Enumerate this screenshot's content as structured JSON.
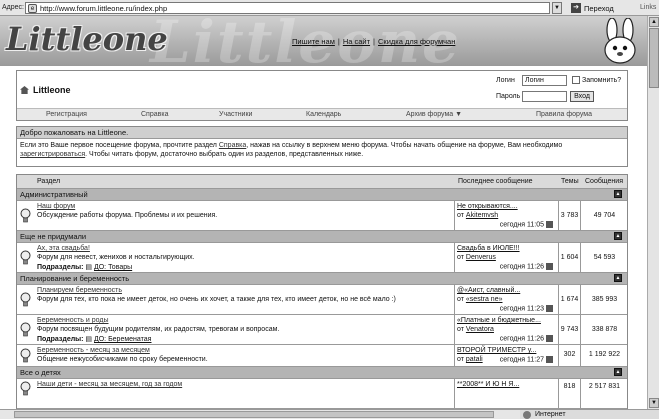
{
  "browser": {
    "address_label": "Адрес:",
    "url": "http://www.forum.littleone.ru/index.php",
    "go_label": "Переход",
    "links_label": "Links"
  },
  "banner": {
    "logo_text": "Littleone",
    "links": [
      "Пишите нам",
      "На сайт",
      "Скидка для форумчан"
    ]
  },
  "header": {
    "site_title": "Littleone",
    "login_label": "Логин",
    "login_value": "Логин",
    "remember_label": "Запомнить?",
    "password_label": "Пароль",
    "enter_label": "Вход",
    "nav": [
      "Регистрация",
      "Справка",
      "Участники",
      "Календарь",
      "Архив форума ▼",
      "Правила форума"
    ]
  },
  "welcome": {
    "title": "Добро пожаловать на Littleone.",
    "text1": "Если это Ваше первое посещение форума, прочтите раздел",
    "link_help": "Справка",
    "text2": ", нажав на ссылку в верхнем меню форума. Чтобы начать общение на форуме, Вам необходимо",
    "link_register": "зарегистрироваться",
    "text3": ". Чтобы читать форум, достаточно выбрать один из разделов, представленных ниже."
  },
  "table": {
    "col_section": "Раздел",
    "col_last": "Последнее сообщение",
    "col_topics": "Темы",
    "col_messages": "Сообщения",
    "categories": [
      {
        "title": "Административный",
        "forums": [
          {
            "name": "Наш форум",
            "desc": "Обсуждение работы форума. Проблемы и их решения.",
            "sub_label": "",
            "sub_link": "",
            "last_title": "Не открываются....",
            "last_by": "от",
            "last_author": "Akitemvsh",
            "last_time": "сегодня 11:05",
            "topics": "3 783",
            "messages": "49 704"
          }
        ]
      },
      {
        "title": "Еще не придумали",
        "forums": [
          {
            "name": "Ах, эта свадьба!",
            "desc": "Форум для невест, женихов и ностальгирующих.",
            "sub_label": "Подразделы:",
            "sub_link": "ДО: Товары",
            "last_title": "Свадьба в ИЮЛЕ!!!",
            "last_by": "от",
            "last_author": "Denverus",
            "last_time": "сегодня 11:26",
            "topics": "1 604",
            "messages": "54 593"
          }
        ]
      },
      {
        "title": "Планирование и беременность",
        "forums": [
          {
            "name": "Планируем беременность",
            "desc": "Форум для тех, кто пока не имеет деток, но очень их хочет, а также для тех, кто имеет деток, но не всё мало :)",
            "sub_label": "",
            "sub_link": "",
            "last_title": "@«Аист, славный...",
            "last_by": "от",
            "last_author": "«sestra ne»",
            "last_time": "сегодня 11:23",
            "topics": "1 674",
            "messages": "385 993"
          },
          {
            "name": "Беременность и роды",
            "desc": "Форум посвящен будущим родителям, их радостям, тревогам и вопросам.",
            "sub_label": "Подразделы:",
            "sub_link": "ДО: Беременатая",
            "last_title": "«Платные и бюджетные...",
            "last_by": "от",
            "last_author": "Venatora",
            "last_time": "сегодня 11:26",
            "topics": "9 743",
            "messages": "338 878"
          },
          {
            "name": "Беременность - месяц за месяцем",
            "desc": "Общение нежусобисчиками по сроку беременности.",
            "sub_label": "",
            "sub_link": "",
            "last_title": "ВТОРОЙ ТРИМЕСТР у...",
            "last_by": "от",
            "last_author": "patali",
            "last_time": "сегодня 11:27",
            "topics": "302",
            "messages": "1 192 922"
          }
        ]
      },
      {
        "title": "Все о детях",
        "forums": [
          {
            "name": "Наши дети - месяц за месяцем, год за годом",
            "desc": "",
            "sub_label": "",
            "sub_link": "",
            "last_title": "**2008** И Ю Н Я...",
            "last_by": "",
            "last_author": "",
            "last_time": "",
            "topics": "818",
            "messages": "2 517 831"
          }
        ]
      }
    ]
  },
  "status": {
    "zone": "Интернет"
  }
}
